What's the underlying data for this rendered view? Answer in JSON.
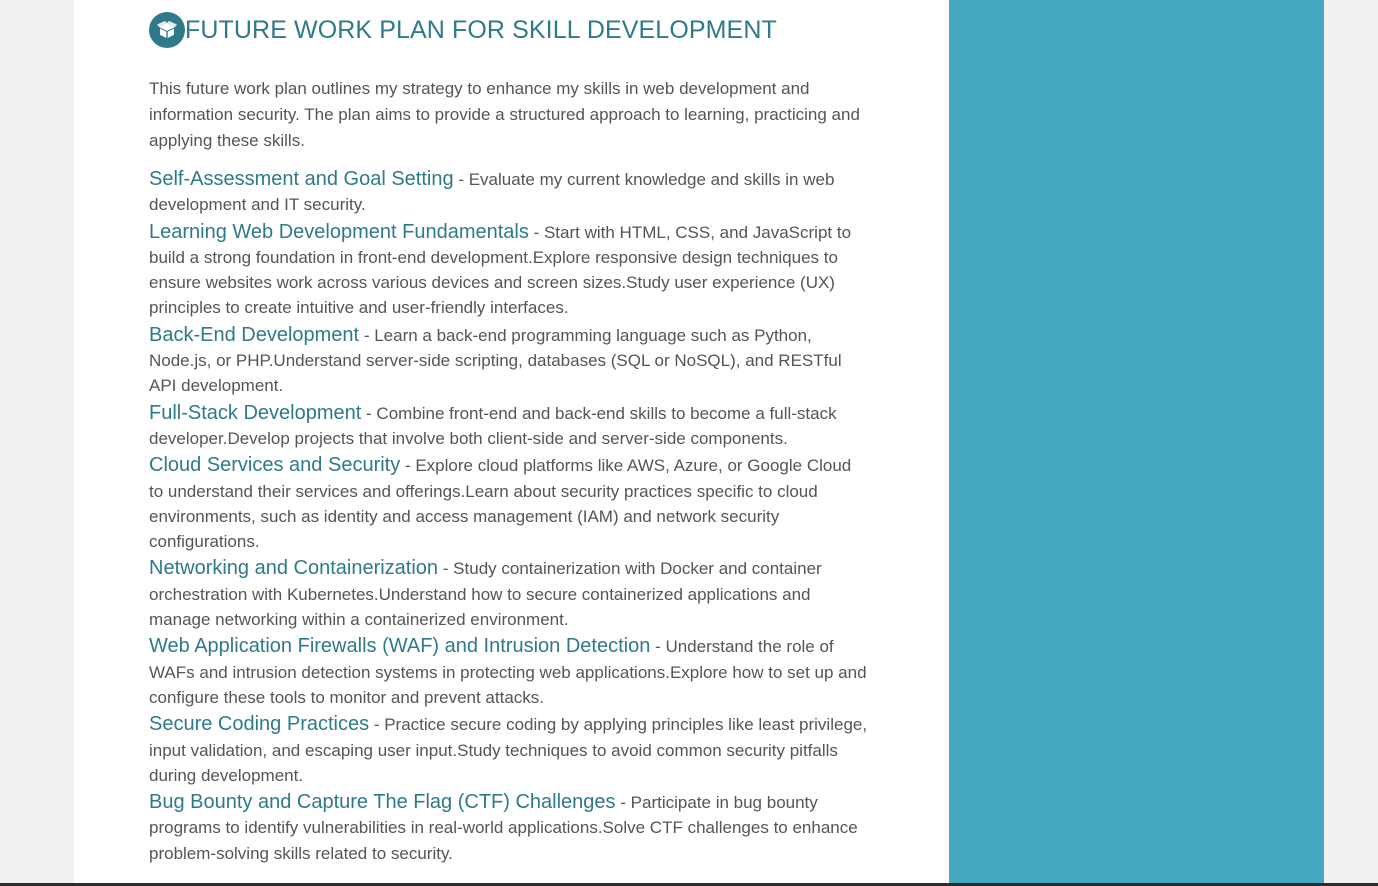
{
  "header": {
    "title": "FUTURE WORK PLAN FOR SKILL DEVELOPMENT",
    "icon": "open-box-icon"
  },
  "intro": "This future work plan outlines my strategy to enhance my skills in web development and information security. The plan aims to provide a structured approach to learning, practicing and applying these skills.",
  "separator": " - ",
  "items": [
    {
      "title": "Self-Assessment and Goal Setting",
      "text": "Evaluate my current knowledge and skills in web development and IT security."
    },
    {
      "title": "Learning Web Development Fundamentals",
      "text": "Start with HTML, CSS, and JavaScript to build a strong foundation in front-end development.Explore responsive design techniques to ensure websites work across various devices and screen sizes.Study user experience (UX) principles to create intuitive and user-friendly interfaces."
    },
    {
      "title": "Back-End Development",
      "text": "Learn a back-end programming language such as Python, Node.js, or PHP.Understand server-side scripting, databases (SQL or NoSQL), and RESTful API development."
    },
    {
      "title": "Full-Stack Development",
      "text": "Combine front-end and back-end skills to become a full-stack developer.Develop projects that involve both client-side and server-side components."
    },
    {
      "title": "Cloud Services and Security",
      "text": "Explore cloud platforms like AWS, Azure, or Google Cloud to understand their services and offerings.Learn about security practices specific to cloud environments, such as identity and access management (IAM) and network security configurations."
    },
    {
      "title": "Networking and Containerization",
      "text": "Study containerization with Docker and container orchestration with Kubernetes.Understand how to secure containerized applications and manage networking within a containerized environment."
    },
    {
      "title": "Web Application Firewalls (WAF) and Intrusion Detection",
      "text": "Understand the role of WAFs and intrusion detection systems in protecting web applications.Explore how to set up and configure these tools to monitor and prevent attacks."
    },
    {
      "title": "Secure Coding Practices",
      "text": "Practice secure coding by applying principles like least privilege, input validation, and escaping user input.Study techniques to avoid common security pitfalls during development."
    },
    {
      "title": "Bug Bounty and Capture The Flag (CTF) Challenges",
      "text": "Participate in bug bounty programs to identify vulnerabilities in real-world applications.Solve CTF challenges to enhance problem-solving skills related to security."
    }
  ],
  "colors": {
    "accent": "#2f7a8a",
    "side_panel": "#44a8c0",
    "body_text": "#555555",
    "background": "#f1f1f1"
  }
}
